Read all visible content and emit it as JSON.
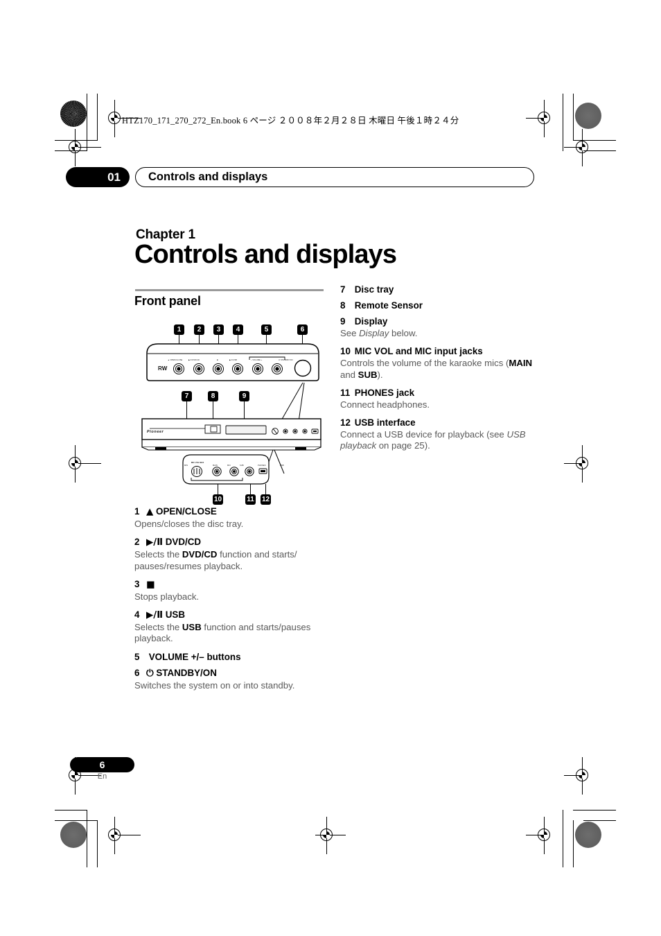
{
  "running_header": "HTZ170_171_270_272_En.book   6 ページ   ２００８年２月２８日   木曜日   午後１時２４分",
  "chapter_bar": {
    "number": "01",
    "title": "Controls and displays"
  },
  "chapter": {
    "label": "Chapter 1",
    "title": "Controls and displays"
  },
  "section": {
    "heading": "Front panel"
  },
  "footer": {
    "page": "6",
    "lang": "En"
  },
  "diagram": {
    "brand": "Pioneer",
    "rw_badge": "RW",
    "top_labels": [
      "▲ OPEN/CLOSE",
      "▶/II DVD/CD",
      "■",
      "▶/II USB",
      "–    VOLUME    +",
      "⏻ STANDBY/ON"
    ],
    "bottom_labels": [
      "MIN",
      "MIC VOL MAX",
      "MAIN",
      "MIC",
      "SUB",
      "PHONES",
      "USB"
    ],
    "callouts": [
      "1",
      "2",
      "3",
      "4",
      "5",
      "6",
      "7",
      "8",
      "9",
      "10",
      "11",
      "12"
    ]
  },
  "items_left": [
    {
      "num": "1",
      "glyph": "▲",
      "title": "OPEN/CLOSE",
      "body_html": "Opens/closes the disc tray."
    },
    {
      "num": "2",
      "glyph": "▶/Ⅱ",
      "title": "DVD/CD",
      "body_html": "Selects the <b>DVD/CD</b> function and starts/ pauses/resumes playback."
    },
    {
      "num": "3",
      "glyph": "■",
      "title": "",
      "body_html": "Stops playback."
    },
    {
      "num": "4",
      "glyph": "▶/Ⅱ",
      "title": "USB",
      "body_html": "Selects the <b>USB</b> function and starts/pauses playback."
    },
    {
      "num": "5",
      "glyph": "",
      "title": "VOLUME +/– buttons",
      "body_html": ""
    },
    {
      "num": "6",
      "glyph": "⏻",
      "title": "STANDBY/ON",
      "body_html": "Switches the system on or into standby."
    }
  ],
  "items_right": [
    {
      "num": "7",
      "glyph": "",
      "title": "Disc tray",
      "body_html": ""
    },
    {
      "num": "8",
      "glyph": "",
      "title": "Remote Sensor",
      "body_html": ""
    },
    {
      "num": "9",
      "glyph": "",
      "title": "Display",
      "body_html": "See <i>Display</i> below."
    },
    {
      "num": "10",
      "glyph": "",
      "title": "MIC VOL and MIC input jacks",
      "body_html": "Controls the volume of the karaoke mics (<b>MAIN</b> and <b>SUB</b>)."
    },
    {
      "num": "11",
      "glyph": "",
      "title": "PHONES jack",
      "body_html": "Connect headphones."
    },
    {
      "num": "12",
      "glyph": "",
      "title": "USB interface",
      "body_html": "Connect a USB device for playback (see <i>USB playback</i> on page 25)."
    }
  ]
}
